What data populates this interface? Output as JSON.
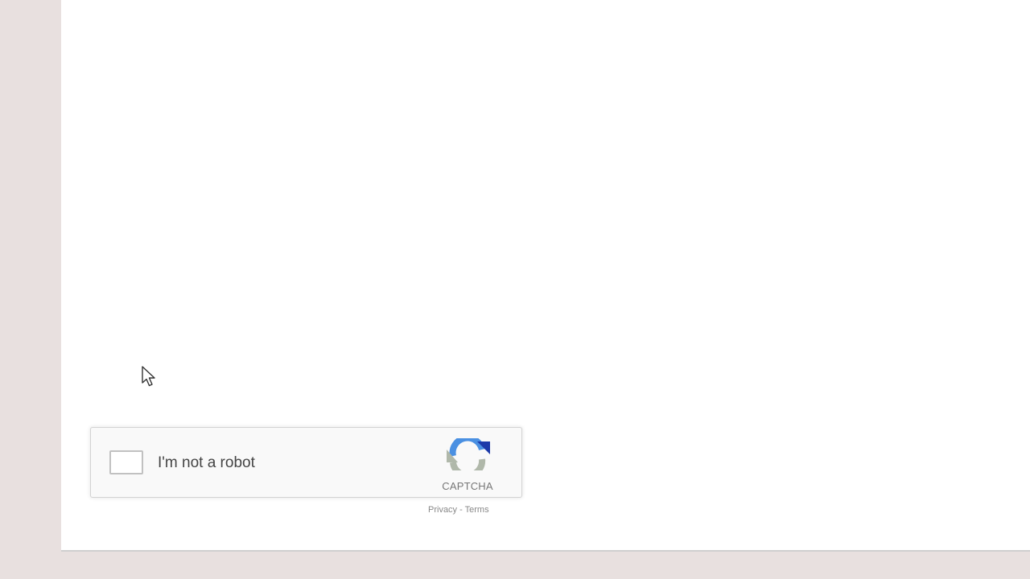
{
  "recaptcha": {
    "label": "I'm not a robot",
    "brand": "CAPTCHA",
    "privacy_label": "Privacy",
    "separator": " - ",
    "terms_label": "Terms",
    "logo_icon": "recaptcha-logo-icon",
    "checkbox_checked": false
  },
  "colors": {
    "background": "#e8e0df",
    "page": "#ffffff",
    "widget": "#f9f9f9",
    "logo_blue": "#4a90e2",
    "logo_dark_blue": "#1c3aa9",
    "logo_gray": "#b0b8aa"
  }
}
